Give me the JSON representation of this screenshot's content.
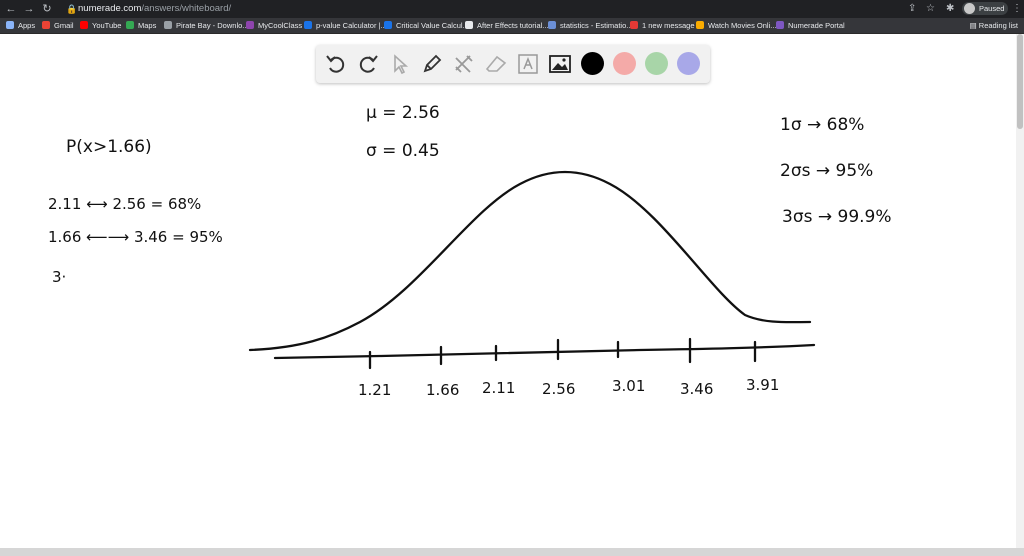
{
  "browser": {
    "url_host": "numerade.com",
    "url_path": "/answers/whiteboard/",
    "profile_label": "Paused",
    "reading_list": "Reading list",
    "bookmarks": [
      {
        "label": "Apps",
        "color": "#8ab4f8"
      },
      {
        "label": "Gmail",
        "color": "#ea4335"
      },
      {
        "label": "YouTube",
        "color": "#ff0000"
      },
      {
        "label": "Maps",
        "color": "#34a853"
      },
      {
        "label": "Pirate Bay - Downlo...",
        "color": "#9aa0a6"
      },
      {
        "label": "MyCoolClass",
        "color": "#8e44ad"
      },
      {
        "label": "p-value Calculator |...",
        "color": "#1a73e8"
      },
      {
        "label": "Critical Value Calcul...",
        "color": "#1a73e8"
      },
      {
        "label": "After Effects tutorial...",
        "color": "#e8eaed"
      },
      {
        "label": "statistics - Estimatio...",
        "color": "#6b8fd6"
      },
      {
        "label": "1 new message",
        "color": "#e53935"
      },
      {
        "label": "Watch Movies Onli...",
        "color": "#f9ab00"
      },
      {
        "label": "Numerade Portal",
        "color": "#7e57c2"
      }
    ]
  },
  "toolbar": {
    "tools": [
      "undo-icon",
      "redo-icon",
      "pointer-icon",
      "pen-icon",
      "tools-icon",
      "eraser-icon",
      "text-icon",
      "image-icon"
    ],
    "colors": [
      "#000000",
      "#f4aaa8",
      "#a8d5a8",
      "#a8a8e8"
    ]
  },
  "whiteboard": {
    "question": "P(x>1.66)",
    "mean": "μ = 2.56",
    "sd": "σ = 0.45",
    "range_1": "2.11 ⟷ 2.56 = 68%",
    "range_2": "1.66 ⟵⟶ 3.46 = 95%",
    "range_3": "3·",
    "rule_1": "1σ → 68%",
    "rule_2": "2σs → 95%",
    "rule_3": "3σs → 99.9%",
    "ticks": [
      "1.21",
      "1.66",
      "2.11",
      "2.56",
      "3.01",
      "3.46",
      "3.91"
    ]
  }
}
